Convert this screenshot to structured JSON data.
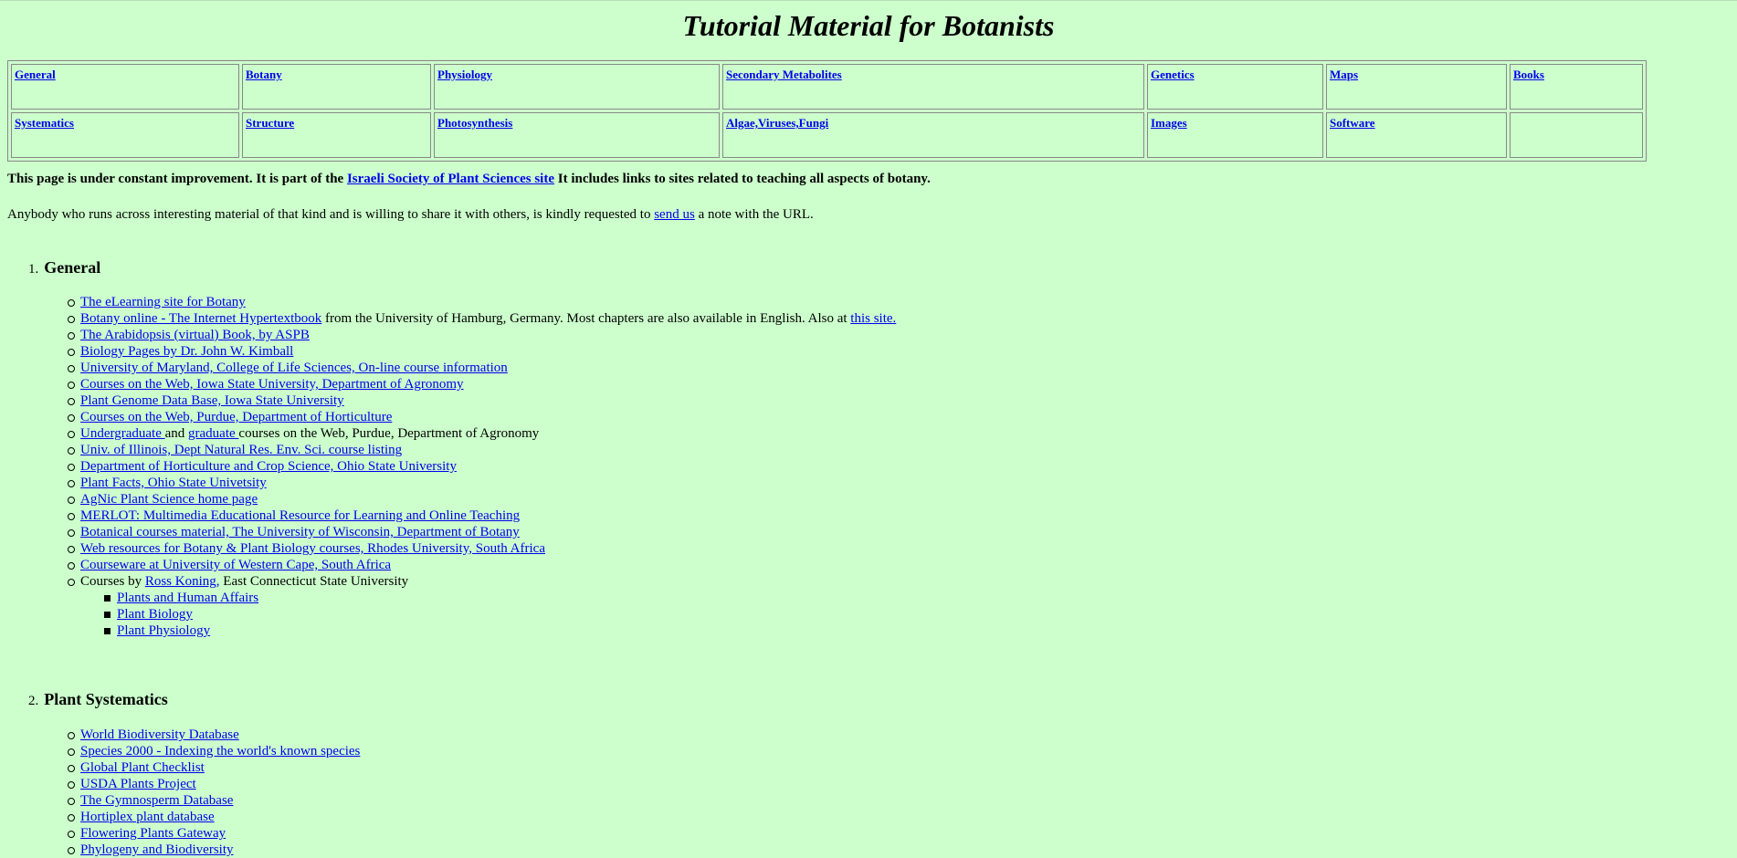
{
  "page": {
    "title": "Tutorial Material for Botanists"
  },
  "nav": {
    "row1": [
      "General",
      "Botany",
      "Physiology",
      "Secondary Metabolites",
      "Genetics",
      "Maps",
      "Books"
    ],
    "row2": [
      "Systematics",
      "Structure",
      "Photosynthesis",
      "Algae,Viruses,Fungi",
      "Images",
      "Software",
      ""
    ]
  },
  "intro": {
    "p1_before": "This page is under constant improvement. It is part of the ",
    "p1_link": "Israeli Society of Plant Sciences site",
    "p1_after": " It includes links to sites related to teaching all aspects of botany.",
    "p2_before": "Anybody who runs across interesting material of that kind and is willing to share it with others, is kindly requested to ",
    "p2_link": "send us",
    "p2_after": " a note with the URL."
  },
  "sections": {
    "general": {
      "number": "1.",
      "heading": "General",
      "items": [
        "The eLearning site for Botany",
        "Botany online - The Internet Hypertextbook",
        "The Arabidopsis (virtual) Book, by ASPB",
        "Biology Pages by Dr. John W. Kimball",
        "University of Maryland, College of Life Sciences, On-line course information",
        "Courses on the Web, Iowa State University, Department of Agronomy",
        "Plant Genome Data Base, Iowa State University",
        "Courses on the Web, Purdue, Department of Horticulture",
        "Undergraduate ",
        "Univ. of Illinois, Dept Natural Res. Env. Sci. course listing",
        "Department of Horticulture and Crop Science, Ohio State University",
        "Plant Facts, Ohio State Univetsity",
        "AgNic Plant Science home page",
        "MERLOT: Multimedia Educational Resource for Learning and Online Teaching",
        "Botanical courses material, The University of Wisconsin, Department of Botany",
        "Web resources for Botany & Plant Biology courses, Rhodes University, South Africa",
        "Courseware at University of Western Cape, South Africa"
      ],
      "botany_online_after": " from the University of Hamburg, Germany. Most chapters are also available in English. Also at ",
      "botany_online_link2": "this site.",
      "purdue_and": "and ",
      "purdue_grad": "graduate ",
      "purdue_after": "courses on the Web, Purdue, Department of Agronomy",
      "koning_before": "Courses by ",
      "koning_link": "Ross Koning,",
      "koning_after": " East Connecticut State University",
      "koning_sub": [
        "Plants and Human Affairs",
        "Plant Biology",
        "Plant Physiology"
      ]
    },
    "systematics": {
      "number": "2.",
      "heading": "Plant Systematics",
      "items": [
        "World Biodiversity Database",
        "Species 2000 - Indexing the world's known species",
        "Global Plant Checklist",
        "USDA Plants Project",
        "The Gymnosperm Database",
        "Hortiplex plant database",
        "Flowering Plants Gateway",
        "Phylogeny and Biodiversity"
      ]
    }
  }
}
